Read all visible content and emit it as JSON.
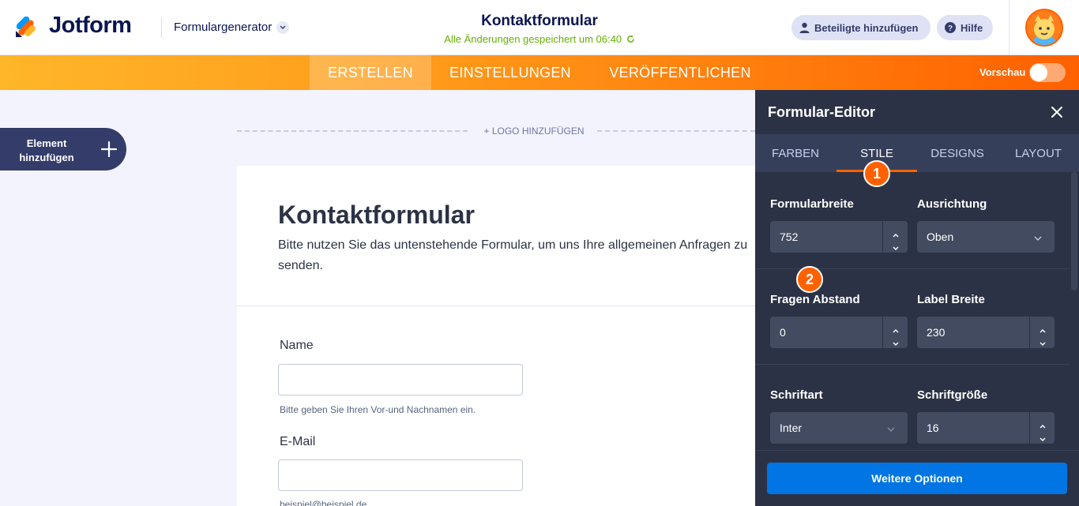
{
  "header": {
    "brand": "Jotform",
    "product": "Formulargenerator",
    "form_title": "Kontaktformular",
    "save_status": "Alle Änderungen gespeichert um 06:40",
    "collab_button": "Beteiligte hinzufügen",
    "help_button": "Hilfe"
  },
  "nav": {
    "tabs": [
      {
        "label": "ERSTELLEN",
        "active": true
      },
      {
        "label": "EINSTELLUNGEN",
        "active": false
      },
      {
        "label": "VERÖFFENTLICHEN",
        "active": false
      }
    ],
    "preview_label": "Vorschau",
    "preview_on": false
  },
  "left": {
    "add_element": "Element hinzufügen"
  },
  "canvas": {
    "add_logo": "+ LOGO HINZUFÜGEN",
    "title": "Kontaktformular",
    "description": "Bitte nutzen Sie das untenstehende Formular, um uns Ihre allgemeinen Anfragen zu senden.",
    "fields": [
      {
        "label": "Name",
        "value": "",
        "hint": "Bitte geben Sie Ihren Vor-und Nachnamen ein."
      },
      {
        "label": "E-Mail",
        "value": "",
        "hint": "beispiel@beispiel.de"
      }
    ]
  },
  "panel": {
    "title": "Formular-Editor",
    "tabs": [
      {
        "label": "FARBEN",
        "active": false
      },
      {
        "label": "STILE",
        "active": true
      },
      {
        "label": "DESIGNS",
        "active": false
      },
      {
        "label": "LAYOUT",
        "active": false
      }
    ],
    "form_width_label": "Formularbreite",
    "form_width_value": "752",
    "alignment_label": "Ausrichtung",
    "alignment_value": "Oben",
    "question_spacing_label": "Fragen Abstand",
    "question_spacing_value": "0",
    "label_width_label": "Label Breite",
    "label_width_value": "230",
    "font_label": "Schriftart",
    "font_value": "Inter",
    "font_size_label": "Schriftgröße",
    "font_size_value": "16",
    "more_options": "Weitere Optionen"
  },
  "markers": [
    "1",
    "2"
  ],
  "colors": {
    "accent_orange": "#ff6100",
    "primary_blue": "#0075e3",
    "navy": "#0a1551",
    "panel_bg": "#2b3245",
    "save_green": "#64b200"
  }
}
